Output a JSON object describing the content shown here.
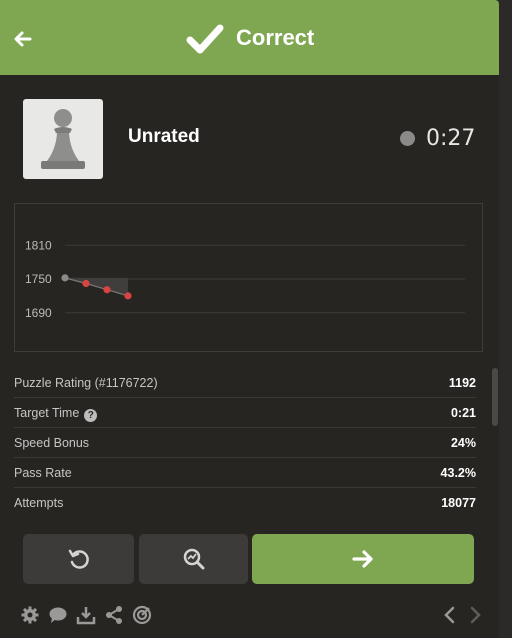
{
  "header": {
    "title": "Correct"
  },
  "player": {
    "name": "Unrated",
    "clock": "0:27"
  },
  "chart_data": {
    "type": "line",
    "y_ticks": [
      "1810",
      "1750",
      "1690"
    ],
    "ylim": [
      1670,
      1830
    ],
    "x": [
      0,
      1,
      2,
      3
    ],
    "series": [
      {
        "values": [
          1752,
          1742,
          1731,
          1720
        ]
      }
    ]
  },
  "stats": [
    {
      "label": "Puzzle Rating (#1176722)",
      "value": "1192"
    },
    {
      "label": "Target Time",
      "value": "0:21"
    },
    {
      "label": "Speed Bonus",
      "value": "24%"
    },
    {
      "label": "Pass Rate",
      "value": "43.2%"
    },
    {
      "label": "Attempts",
      "value": "18077"
    }
  ],
  "icons": {
    "back": "arrow-left-icon",
    "check": "checkmark-icon",
    "retry": "retry-icon",
    "analyze": "magnifier-analysis-icon",
    "next": "arrow-right-icon",
    "settings": "gear-icon",
    "chat": "chat-icon",
    "download": "download-icon",
    "share": "share-icon",
    "target": "target-icon"
  },
  "colors": {
    "accent": "#7fa650",
    "marker": "#d64541"
  }
}
